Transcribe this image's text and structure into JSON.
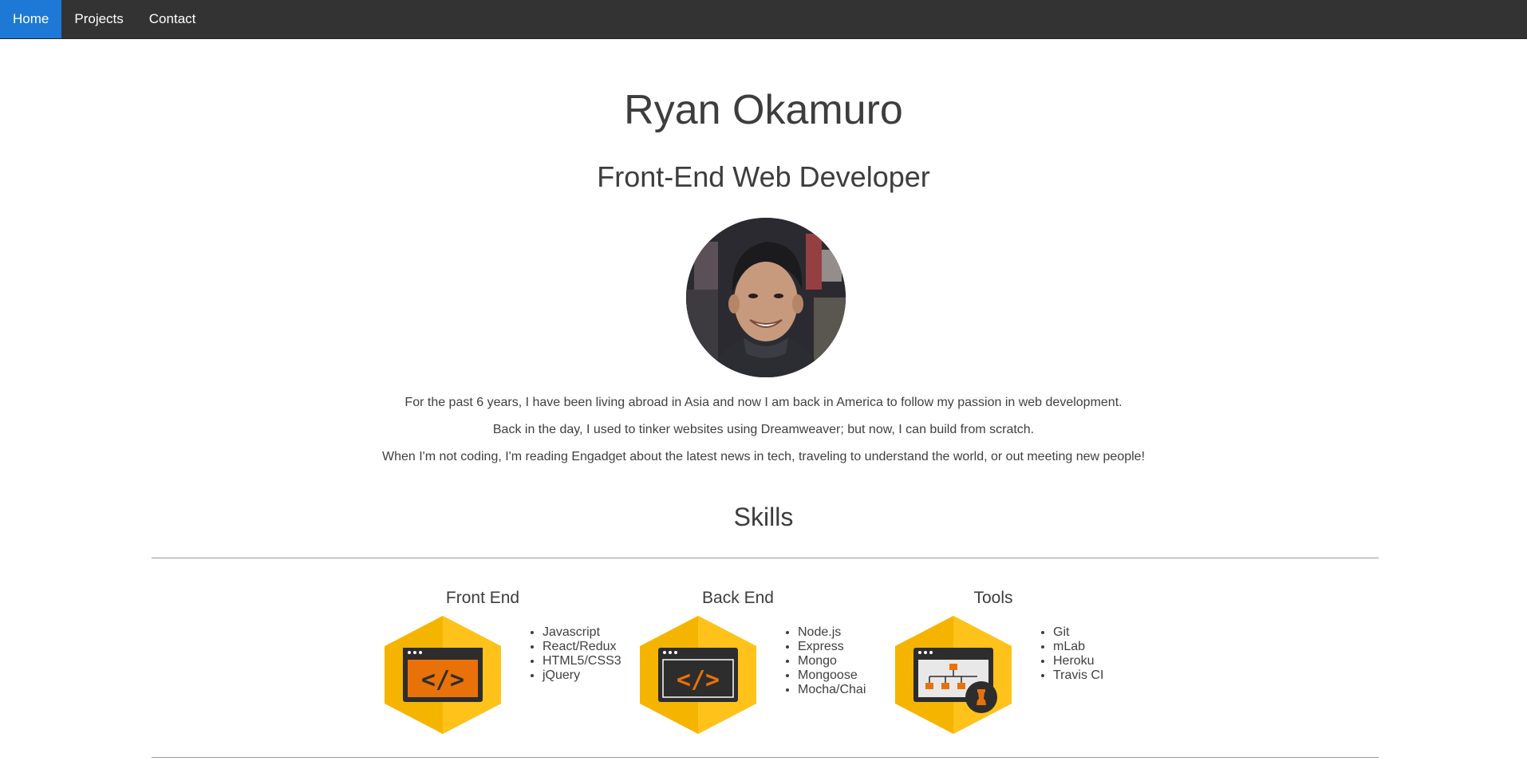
{
  "nav": {
    "items": [
      {
        "label": "Home",
        "active": true
      },
      {
        "label": "Projects",
        "active": false
      },
      {
        "label": "Contact",
        "active": false
      }
    ],
    "accent_color": "#1d78d6",
    "background_color": "#333333"
  },
  "hero": {
    "name": "Ryan Okamuro",
    "role": "Front-End Web Developer",
    "avatar_icon": "profile-photo"
  },
  "bio": {
    "lines": [
      "For the past 6 years, I have been living abroad in Asia and now I am back in America to follow my passion in web development.",
      "Back in the day, I used to tinker websites using Dreamweaver; but now, I can build from scratch.",
      "When I'm not coding, I'm reading Engadget about the latest news in tech, traveling to understand the world, or out meeting new people!"
    ]
  },
  "skills": {
    "title": "Skills",
    "columns": [
      {
        "heading": "Front End",
        "icon": "code-window-icon",
        "items": [
          "Javascript",
          "React/Redux",
          "HTML5/CSS3",
          "jQuery"
        ]
      },
      {
        "heading": "Back End",
        "icon": "code-window-dark-icon",
        "items": [
          "Node.js",
          "Express",
          "Mongo",
          "Mongoose",
          "Mocha/Chai"
        ]
      },
      {
        "heading": "Tools",
        "icon": "sitemap-chess-icon",
        "items": [
          "Git",
          "mLab",
          "Heroku",
          "Travis CI"
        ]
      }
    ],
    "hex_color": "#f5b400",
    "icon_accent": "#e8710a"
  }
}
